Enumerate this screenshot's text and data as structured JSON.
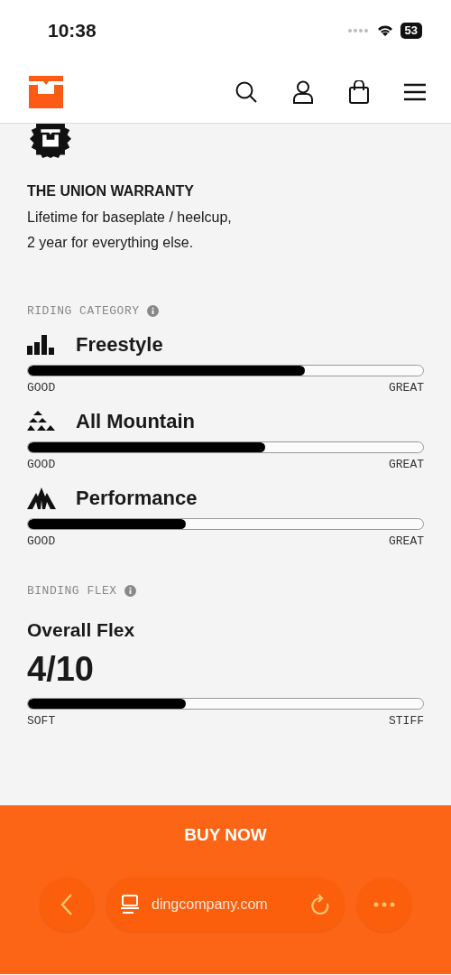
{
  "status_bar": {
    "time": "10:38",
    "battery": "53"
  },
  "warranty": {
    "title": "THE UNION WARRANTY",
    "text": "Lifetime for baseplate / heelcup,\n2 year for everything else."
  },
  "riding_category": {
    "label": "RIDING CATEGORY",
    "items": [
      {
        "kind": "freestyle",
        "name": "Freestyle",
        "level": 0.7,
        "min_label": "GOOD",
        "max_label": "GREAT"
      },
      {
        "kind": "all_mountain",
        "name": "All Mountain",
        "level": 0.6,
        "min_label": "GOOD",
        "max_label": "GREAT"
      },
      {
        "kind": "performance",
        "name": "Performance",
        "level": 0.4,
        "min_label": "GOOD",
        "max_label": "GREAT"
      }
    ]
  },
  "binding_flex": {
    "label": "BINDING FLEX",
    "title": "Overall Flex",
    "value": "4/10",
    "level": 0.4,
    "min_label": "SOFT",
    "max_label": "STIFF"
  },
  "buy_button": "BUY NOW",
  "browser_bar": {
    "url": "dingcompany.com"
  }
}
